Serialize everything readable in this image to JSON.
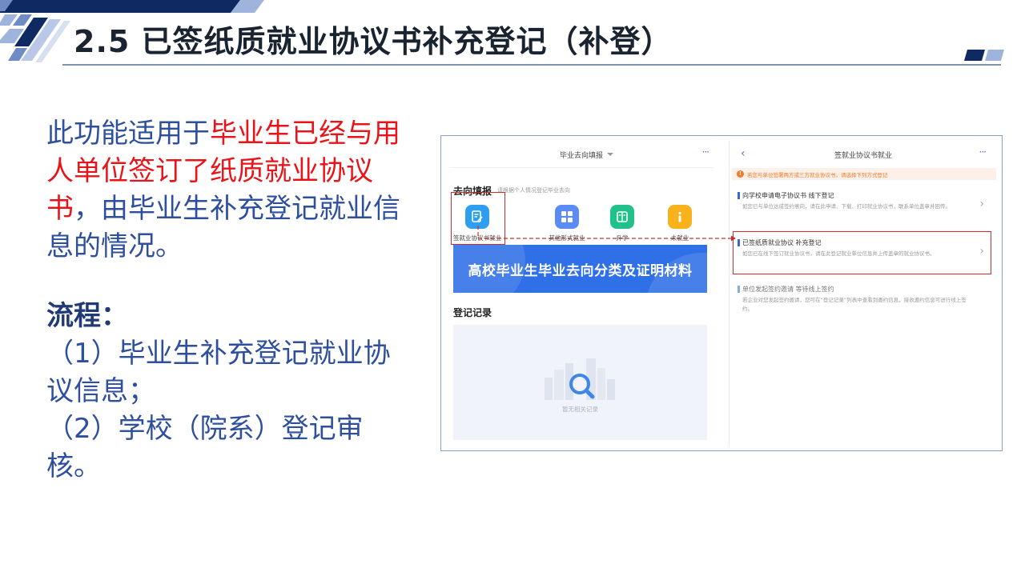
{
  "slide": {
    "title": "2.5 已签纸质就业协议书补充登记（补登）",
    "desc_part1": "此功能适用于",
    "desc_highlight": "毕业生已经与用人单位签订了纸质就业协议书",
    "desc_part2": "，由毕业生补充登记就业信息的情况。",
    "flow_title": "流程：",
    "flow_step1": "（1）毕业生补充登记就业协议信息；",
    "flow_step2": "（2）学校（院系）登记审核。"
  },
  "screenshot": {
    "left_panel": {
      "header_title": "毕业去向填报",
      "more": "···",
      "section_title": "去向填报",
      "section_hint": "请根据个人情况登记毕业去向",
      "tiles": [
        {
          "label": "签就业协议书就业",
          "icon": "edit-doc-icon",
          "color": "#2e9ef0"
        },
        {
          "label": "其他形式就业",
          "icon": "grid-icon",
          "color": "#5b8cf5"
        },
        {
          "label": "升学",
          "icon": "book-icon",
          "color": "#22c08a"
        },
        {
          "label": "未就业",
          "icon": "info-icon",
          "color": "#f8b21c"
        }
      ],
      "banner_text": "高校毕业生毕业去向分类及证明材料",
      "records_title": "登记记录",
      "empty_text": "暂无相关记录"
    },
    "right_panel": {
      "back": "‹",
      "header_title": "签就业协议书就业",
      "more": "···",
      "warning": "若您与单位签署两方或三方就业协议书，请选择下列方式登记",
      "options": [
        {
          "title": "向学校申请电子协议书 线下登记",
          "desc": "如您已与单位达成签约意向，请在此申请、下载、打印就业协议书，联系单位盖章并回传。",
          "arrow": "›"
        },
        {
          "title": "已签纸质就业协议 补充登记",
          "desc": "如您已在线下签订就业协议书，请在此登记就业单位信息并上传盖章的就业协议书。",
          "arrow": "›"
        },
        {
          "title": "单位发起签约邀请 等待线上签约",
          "desc": "若企业对您发起签约邀请，您可在“登记记录”列表中查看到邀约信息，接收邀约信息可进行线上签约。",
          "arrow": ""
        }
      ]
    }
  },
  "colors": {
    "title_text": "#1a2330",
    "body_text": "#2e4f9e",
    "highlight": "#e8141a",
    "accent_blue": "#2f6fe8",
    "frame_red": "#d12b2b"
  }
}
